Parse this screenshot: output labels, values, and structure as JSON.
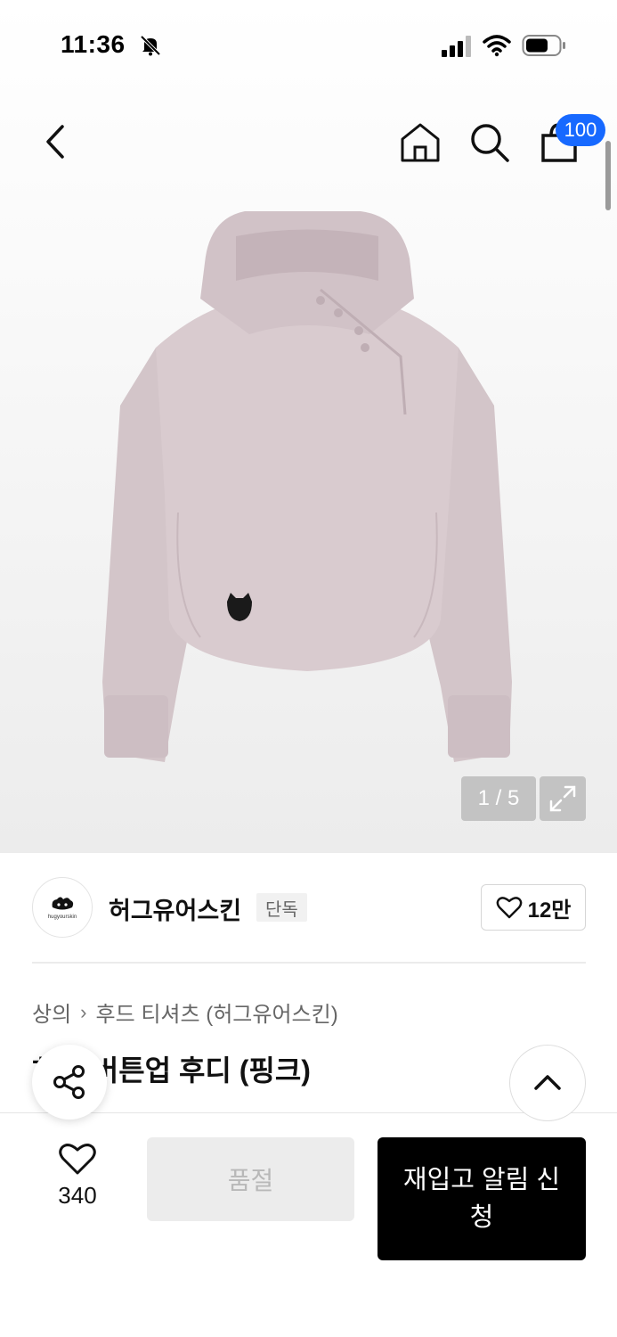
{
  "status_bar": {
    "time": "11:36",
    "icons": [
      "bell-off-icon",
      "cellular-signal-icon",
      "wifi-icon",
      "battery-icon"
    ]
  },
  "header": {
    "icons": [
      "back-arrow-icon",
      "home-icon",
      "search-icon",
      "shopping-bag-icon"
    ],
    "cart_count": "100"
  },
  "gallery": {
    "counter": "1 / 5",
    "expand_icon": "expand-arrows-icon",
    "product_color": "#d7c9cd"
  },
  "brand": {
    "name": "허그유어스킨",
    "logo_text": "hugyourskin",
    "exclusive_tag": "단독",
    "like_count": "12만"
  },
  "breadcrumb": {
    "category": "상의",
    "subcategory": "후드 티셔츠 (허그유어스킨)"
  },
  "product": {
    "title": "허그 버튼업 후디 (핑크)"
  },
  "floating": {
    "share_icon": "share-icon",
    "top_icon": "chevron-up-icon"
  },
  "bottom_bar": {
    "wish_count": "340",
    "soldout_label": "품절",
    "restock_label": "재입고 알림 신청"
  },
  "colors": {
    "accent_blue": "#1769ff",
    "black": "#000000",
    "disabled_bg": "#ececec"
  }
}
